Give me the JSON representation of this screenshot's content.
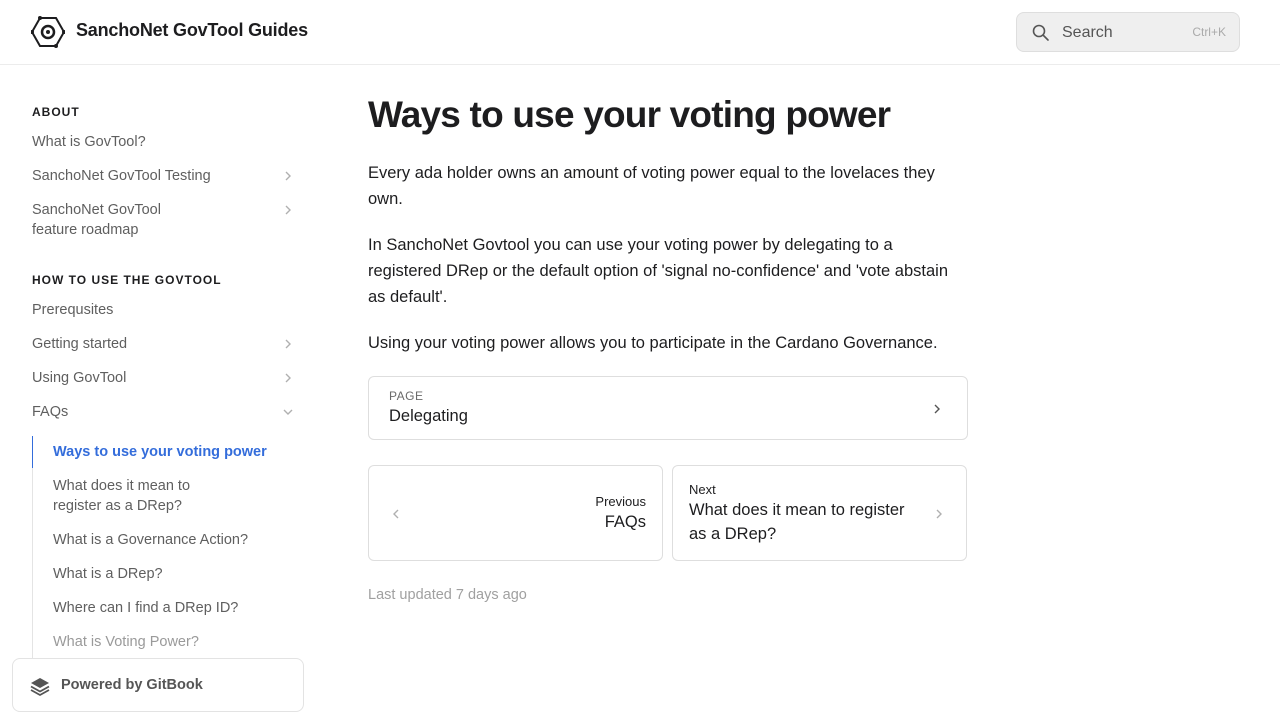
{
  "header": {
    "logo_icon": "govtool-hexagon-logo-icon",
    "site_title": "SanchoNet GovTool Guides",
    "search": {
      "icon": "search-icon",
      "placeholder": "Search",
      "shortcut": "Ctrl+K"
    }
  },
  "sidebar": {
    "sections": [
      {
        "title": "ABOUT",
        "items": [
          {
            "label": "What is GovTool?",
            "expandable": false
          },
          {
            "label": "SanchoNet GovTool Testing",
            "expandable": true
          },
          {
            "label": "SanchoNet GovTool feature roadmap",
            "expandable": true
          }
        ]
      },
      {
        "title": "HOW TO USE THE GOVTOOL",
        "items": [
          {
            "label": "Prerequsites",
            "expandable": false
          },
          {
            "label": "Getting started",
            "expandable": true
          },
          {
            "label": "Using GovTool",
            "expandable": true
          },
          {
            "label": "FAQs",
            "expandable": true,
            "expanded": true
          }
        ]
      }
    ],
    "faq_items": [
      {
        "label": "Ways to use your voting power",
        "active": true
      },
      {
        "label": "What does it mean to register as a DRep?"
      },
      {
        "label": "What is a Governance Action?"
      },
      {
        "label": "What is a DRep?"
      },
      {
        "label": "Where can I find a DRep ID?"
      },
      {
        "label": "What is Voting Power?"
      }
    ],
    "powered_by": {
      "icon": "gitbook-icon",
      "label": "Powered by GitBook"
    }
  },
  "main": {
    "title": "Ways to use your voting power",
    "paragraphs": [
      "Every ada holder owns an amount of voting power equal to the lovelaces they own.",
      "In SanchoNet Govtool you can use your voting power by delegating to a registered DRep or the default option of 'signal no-confidence' and 'vote abstain as default'.",
      "Using your voting power allows you to participate in the Cardano Governance."
    ],
    "page_link": {
      "kind": "PAGE",
      "name": "Delegating"
    },
    "previous": {
      "caption": "Previous",
      "title": "FAQs"
    },
    "next": {
      "caption": "Next",
      "title": "What does it mean to register as a DRep?"
    },
    "last_updated": "Last updated 7 days ago"
  },
  "colors": {
    "accent": "#346ddb",
    "text": "#1d1d1f",
    "muted": "#5f5f5f",
    "border": "#dedede"
  }
}
